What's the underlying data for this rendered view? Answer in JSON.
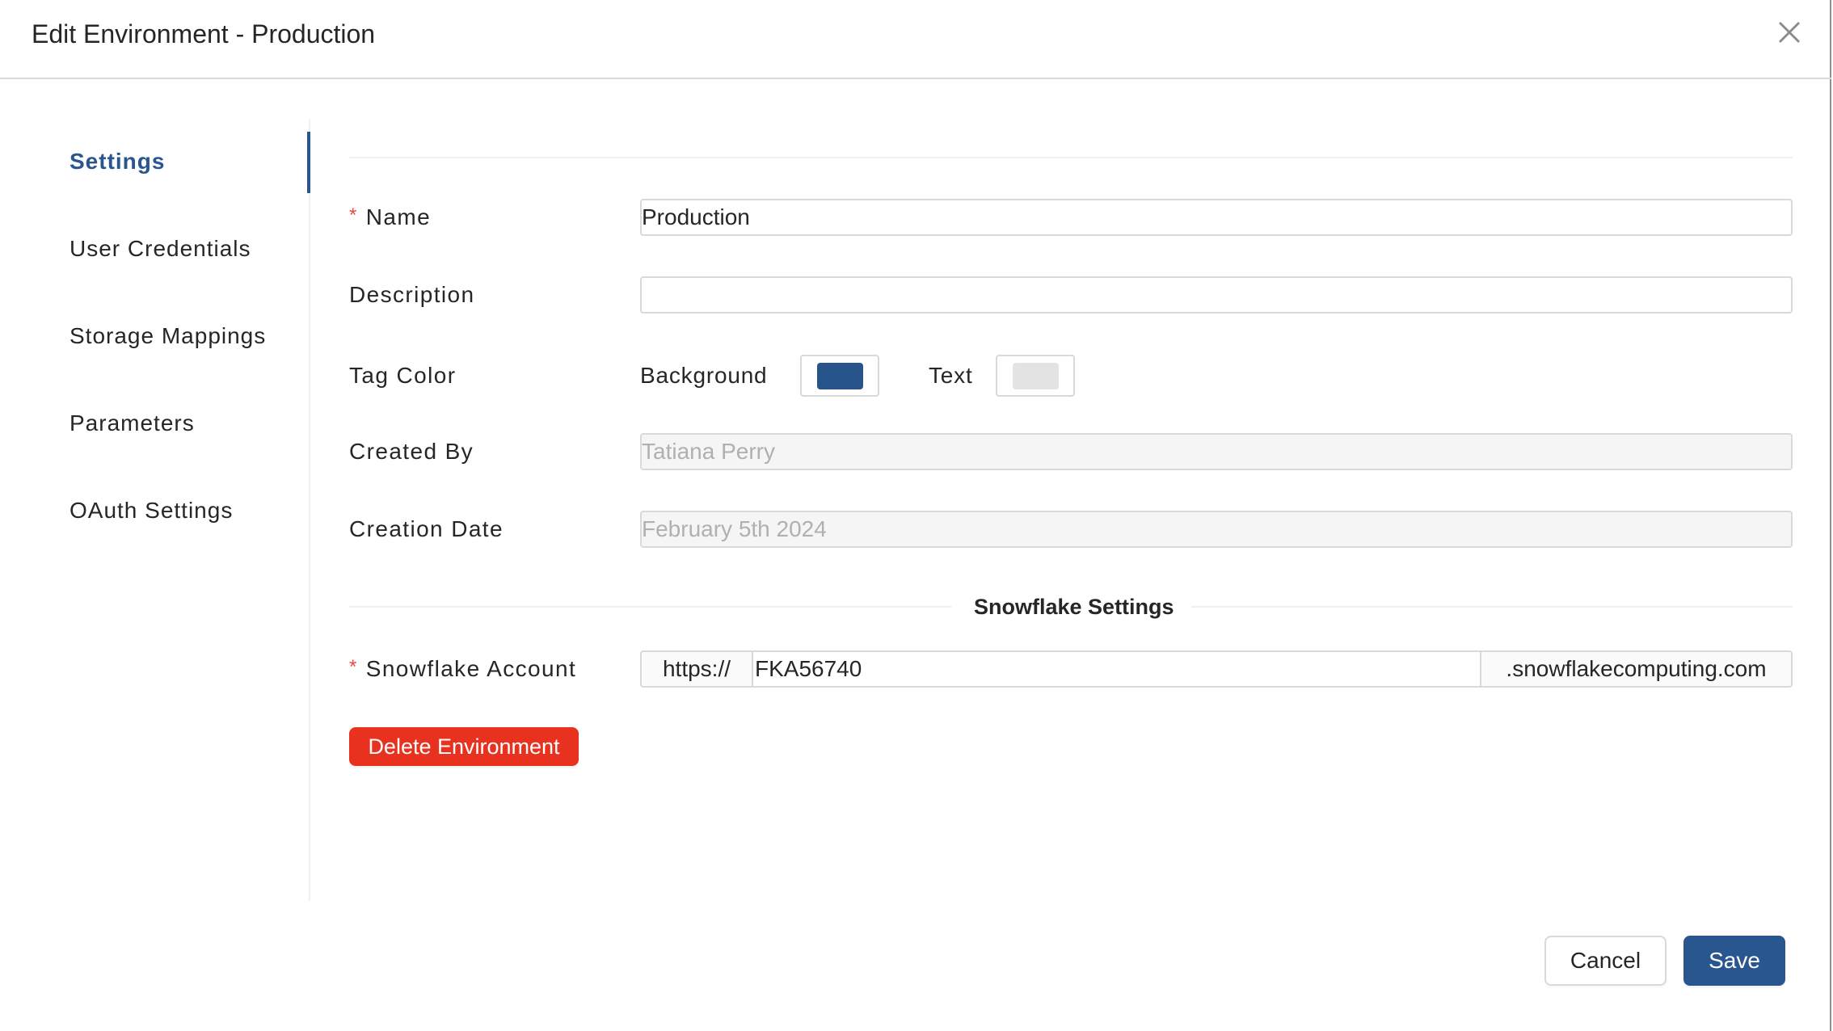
{
  "header": {
    "title": "Edit Environment - Production",
    "close_icon": "close-icon"
  },
  "sidebar": {
    "active_index": 0,
    "items": [
      {
        "label": "Settings",
        "active": true
      },
      {
        "label": "User Credentials",
        "active": false
      },
      {
        "label": "Storage Mappings",
        "active": false
      },
      {
        "label": "Parameters",
        "active": false
      },
      {
        "label": "OAuth Settings",
        "active": false
      }
    ]
  },
  "form": {
    "required_marker": "*",
    "name": {
      "label": "Name",
      "value": "Production",
      "required": true
    },
    "description": {
      "label": "Description",
      "value": "",
      "required": false
    },
    "tag_color": {
      "label": "Tag Color",
      "background_label": "Background",
      "background_color": "#28548c",
      "text_label": "Text",
      "text_color": "#e3e3e3"
    },
    "created_by": {
      "label": "Created By",
      "value": "Tatiana Perry",
      "disabled": true
    },
    "creation_date": {
      "label": "Creation Date",
      "value": "February 5th 2024",
      "disabled": true
    }
  },
  "snowflake": {
    "section_title": "Snowflake Settings",
    "account": {
      "label": "Snowflake Account",
      "required": true,
      "prefix": "https://",
      "value": "FKA56740",
      "suffix": ".snowflakecomputing.com"
    }
  },
  "actions": {
    "delete_label": "Delete Environment",
    "cancel_label": "Cancel",
    "save_label": "Save"
  },
  "colors": {
    "accent": "#2a5690",
    "danger": "#e8321f",
    "required": "#ef4444"
  }
}
